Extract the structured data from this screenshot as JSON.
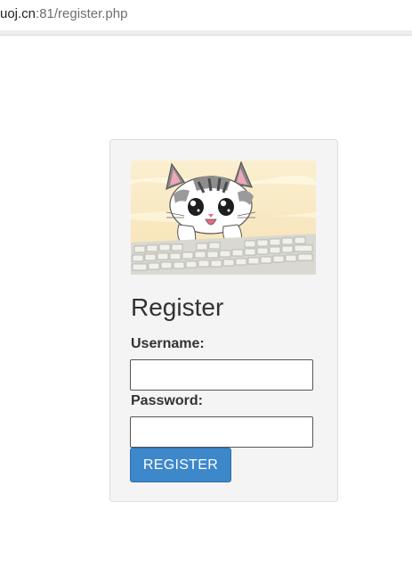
{
  "browser": {
    "url_host": "uoj.cn",
    "url_rest": ":81/register.php"
  },
  "banner": {
    "image": "cartoon-cat-on-keyboard"
  },
  "form": {
    "title": "Register",
    "username_label": "Username:",
    "username_value": "",
    "password_label": "Password:",
    "password_value": "",
    "submit_label": "REGISTER"
  },
  "colors": {
    "button": "#3d87cb",
    "card_background": "#f4f4f4",
    "card_border": "#dddddd"
  }
}
